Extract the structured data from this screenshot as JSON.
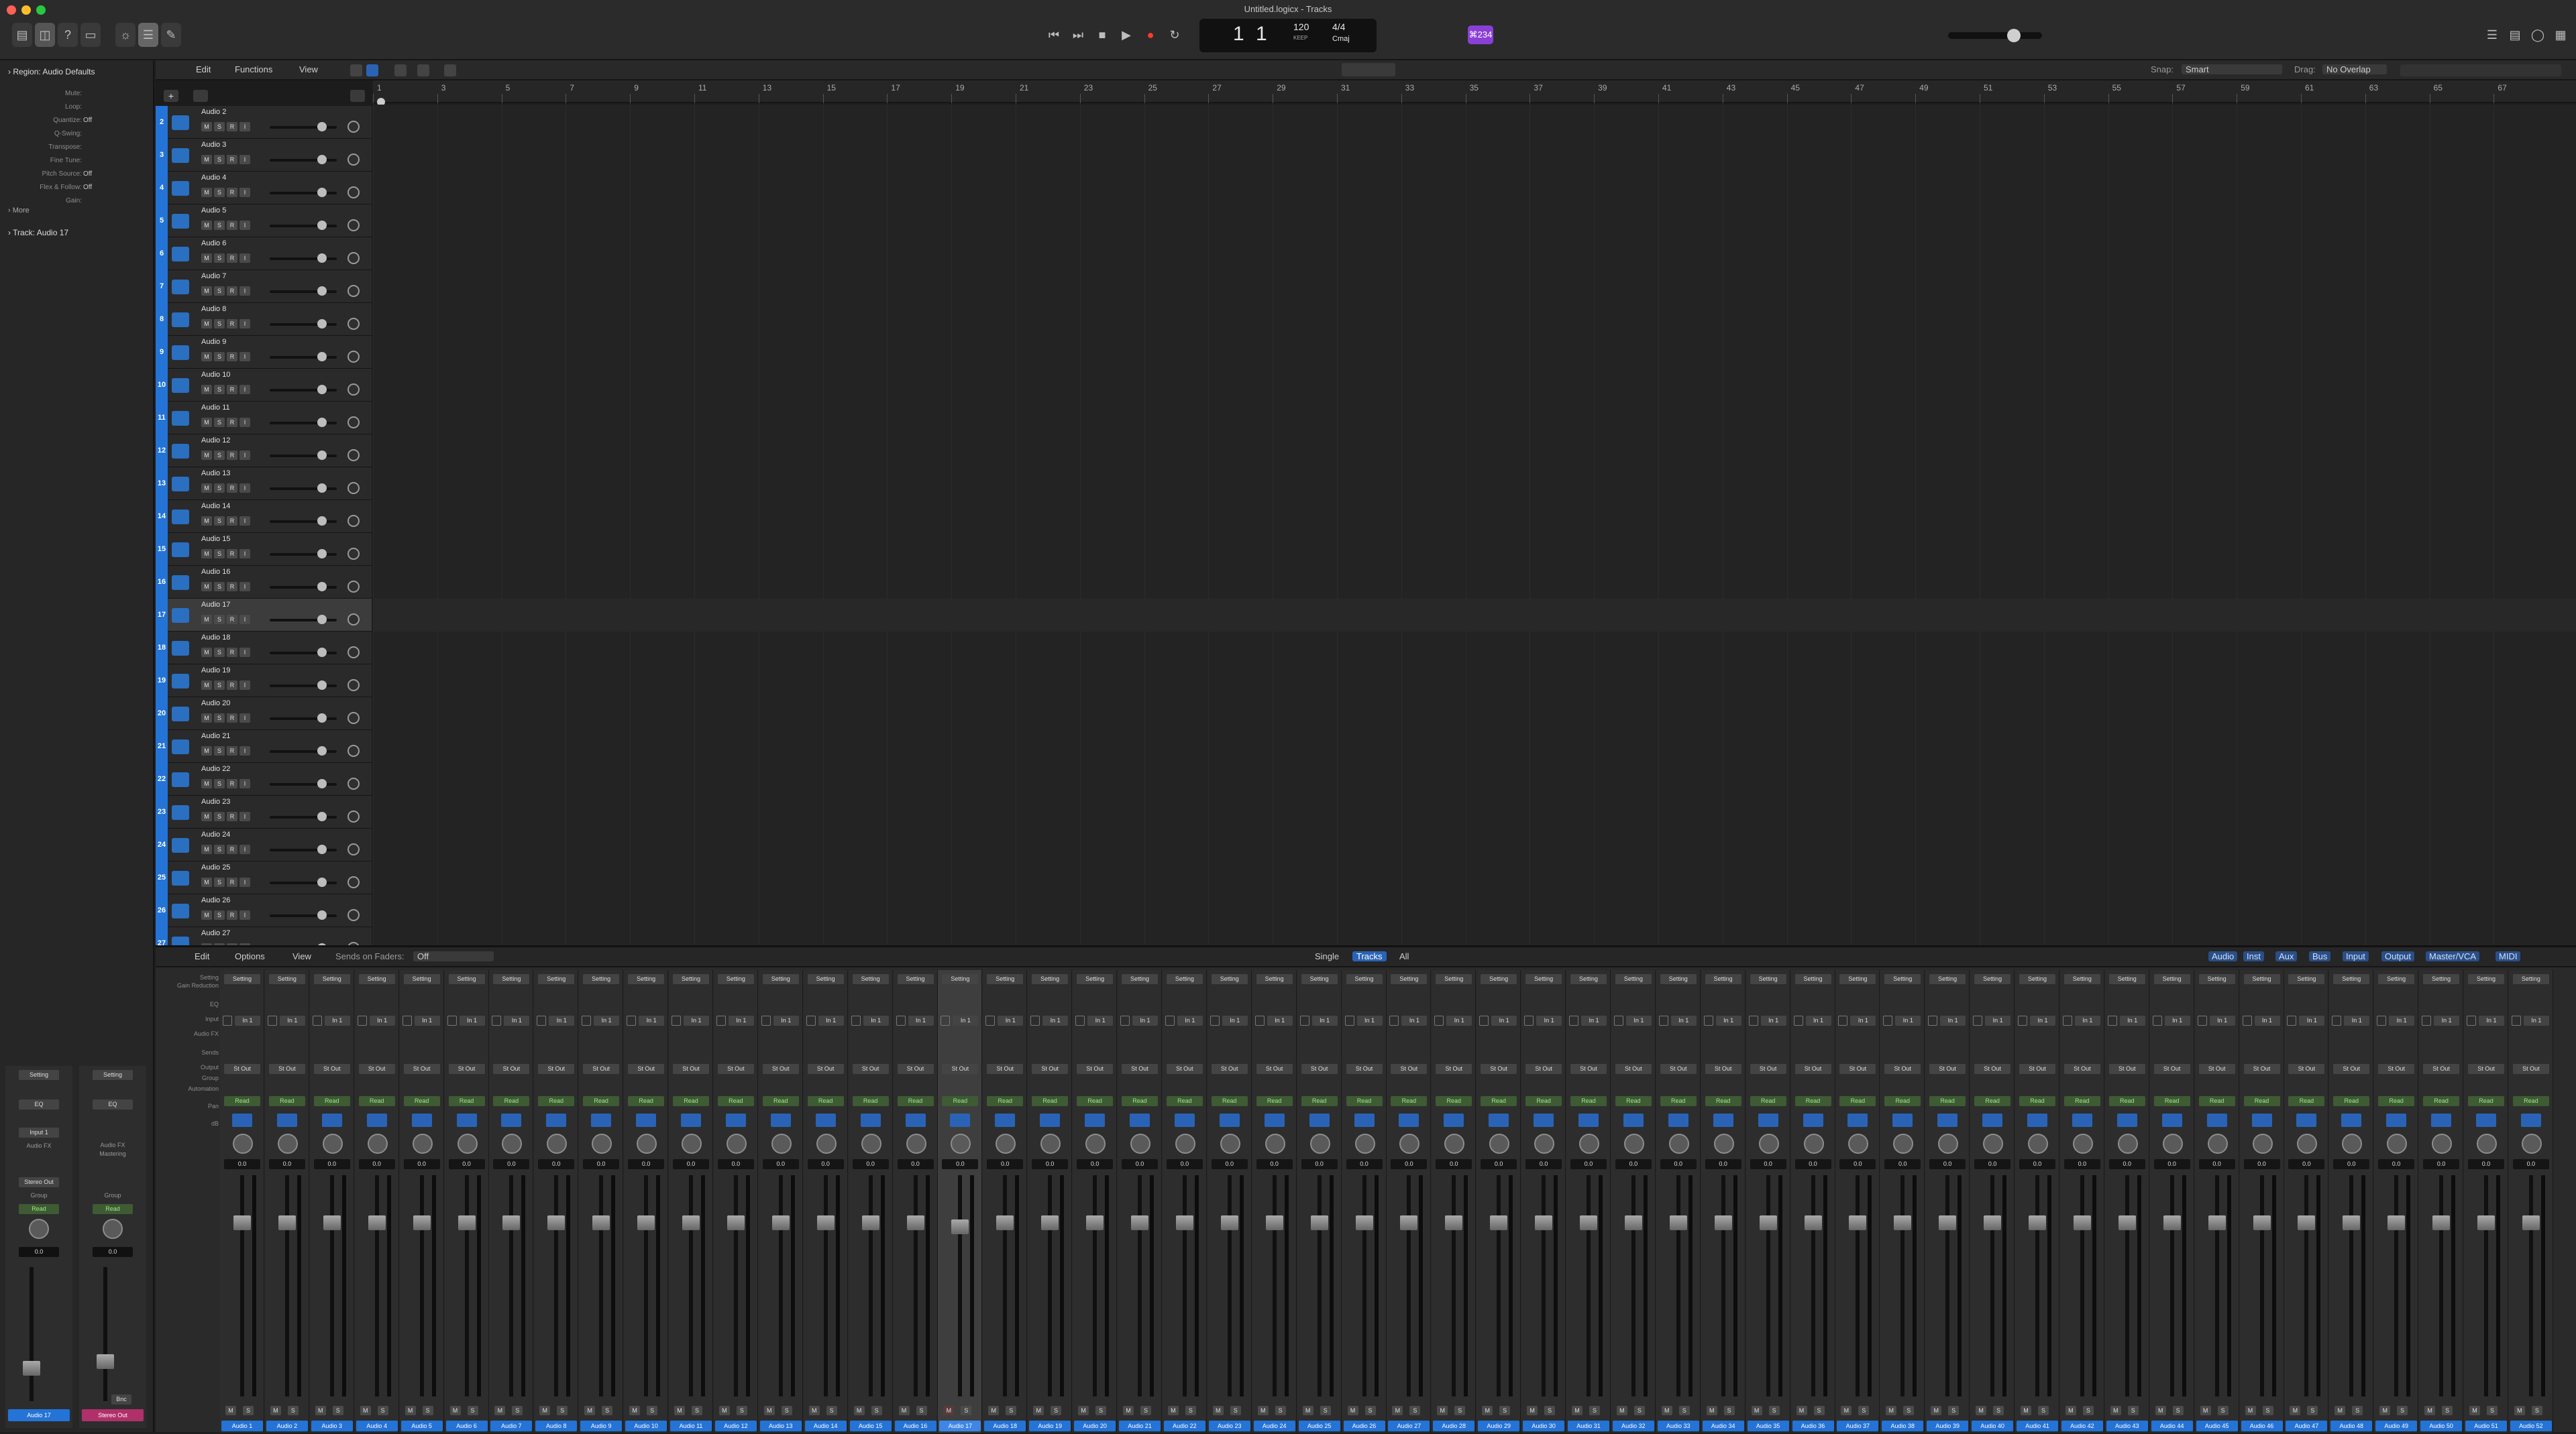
{
  "window": {
    "title": "Untitled.logicx - Tracks"
  },
  "lcd": {
    "bar": "1",
    "beat": "1",
    "tempo": "120",
    "tempo_label": "KEEP",
    "sig": "4/4",
    "key": "Cmaj"
  },
  "badge": "⌘234",
  "inspector": {
    "region_label": "Region:",
    "region_name": "Audio Defaults",
    "rows": [
      {
        "l": "Mute:",
        "v": ""
      },
      {
        "l": "Loop:",
        "v": ""
      },
      {
        "l": "Quantize:",
        "v": "Off"
      },
      {
        "l": "Q-Swing:",
        "v": ""
      },
      {
        "l": "Transpose:",
        "v": ""
      },
      {
        "l": "Fine Tune:",
        "v": ""
      },
      {
        "l": "Pitch Source:",
        "v": "Off"
      },
      {
        "l": "Flex & Follow:",
        "v": "Off"
      },
      {
        "l": "Gain:",
        "v": ""
      }
    ],
    "more": "More",
    "track_label": "Track:",
    "track_name": "Audio 17",
    "strip1": {
      "setting": "Setting",
      "eq": "EQ",
      "input": "Input 1",
      "fx": "Audio FX",
      "group": "Group",
      "read": "Read",
      "out": "Stereo Out",
      "val": "0.0",
      "name": "Audio 17"
    },
    "strip2": {
      "setting": "Setting",
      "eq": "EQ",
      "fx": "Audio FX Mastering",
      "group": "Group",
      "read": "Read",
      "val": "0.0",
      "name": "Stereo Out",
      "bnc": "Bnc"
    }
  },
  "toolbar": {
    "edit": "Edit",
    "functions": "Functions",
    "view": "View",
    "snap_label": "Snap:",
    "snap": "Smart",
    "drag_label": "Drag:",
    "drag": "No Overlap"
  },
  "ruler": [
    "1",
    "3",
    "5",
    "7",
    "9",
    "11",
    "13",
    "15",
    "17",
    "19",
    "21",
    "23",
    "25",
    "27",
    "29",
    "31",
    "33",
    "35",
    "37",
    "39",
    "41",
    "43",
    "45",
    "47",
    "49",
    "51",
    "53",
    "55",
    "57",
    "59",
    "61",
    "63",
    "65",
    "67"
  ],
  "tracks": [
    {
      "n": "2",
      "name": "Audio 2"
    },
    {
      "n": "3",
      "name": "Audio 3"
    },
    {
      "n": "4",
      "name": "Audio 4"
    },
    {
      "n": "5",
      "name": "Audio 5"
    },
    {
      "n": "6",
      "name": "Audio 6"
    },
    {
      "n": "7",
      "name": "Audio 7"
    },
    {
      "n": "8",
      "name": "Audio 8"
    },
    {
      "n": "9",
      "name": "Audio 9"
    },
    {
      "n": "10",
      "name": "Audio 10"
    },
    {
      "n": "11",
      "name": "Audio 11"
    },
    {
      "n": "12",
      "name": "Audio 12"
    },
    {
      "n": "13",
      "name": "Audio 13"
    },
    {
      "n": "14",
      "name": "Audio 14"
    },
    {
      "n": "15",
      "name": "Audio 15"
    },
    {
      "n": "16",
      "name": "Audio 16"
    },
    {
      "n": "17",
      "name": "Audio 17"
    },
    {
      "n": "18",
      "name": "Audio 18"
    },
    {
      "n": "19",
      "name": "Audio 19"
    },
    {
      "n": "20",
      "name": "Audio 20"
    },
    {
      "n": "21",
      "name": "Audio 21"
    },
    {
      "n": "22",
      "name": "Audio 22"
    },
    {
      "n": "23",
      "name": "Audio 23"
    },
    {
      "n": "24",
      "name": "Audio 24"
    },
    {
      "n": "25",
      "name": "Audio 25"
    },
    {
      "n": "26",
      "name": "Audio 26"
    },
    {
      "n": "27",
      "name": "Audio 27"
    }
  ],
  "track_buttons": [
    "M",
    "S",
    "R",
    "I"
  ],
  "mixer": {
    "edit": "Edit",
    "options": "Options",
    "view": "View",
    "sends_label": "Sends on Faders:",
    "sends": "Off",
    "single": "Single",
    "tracks": "Tracks",
    "all": "All",
    "filters": [
      "Audio",
      "Inst",
      "Aux",
      "Bus",
      "Input",
      "Output",
      "Master/VCA",
      "MIDI"
    ],
    "row_labels": [
      "Setting",
      "Gain Reduction",
      "EQ",
      "Input",
      "Audio FX",
      "Sends",
      "Output",
      "Group",
      "Automation",
      "Pan",
      "dB"
    ],
    "strip_setting": "Setting",
    "strip_input": "In 1",
    "strip_output": "St Out",
    "strip_read": "Read",
    "strip_db": "0.0",
    "strips": [
      "Audio 1",
      "Audio 2",
      "Audio 3",
      "Audio 4",
      "Audio 5",
      "Audio 6",
      "Audio 7",
      "Audio 8",
      "Audio 9",
      "Audio 10",
      "Audio 11",
      "Audio 12",
      "Audio 13",
      "Audio 14",
      "Audio 15",
      "Audio 16",
      "Audio 17",
      "Audio 18",
      "Audio 19",
      "Audio 20",
      "Audio 21",
      "Audio 22",
      "Audio 23",
      "Audio 24",
      "Audio 25",
      "Audio 26",
      "Audio 27",
      "Audio 28",
      "Audio 29",
      "Audio 30",
      "Audio 31",
      "Audio 32",
      "Audio 33",
      "Audio 34",
      "Audio 35",
      "Audio 36",
      "Audio 37",
      "Audio 38",
      "Audio 39",
      "Audio 40",
      "Audio 41",
      "Audio 42",
      "Audio 43",
      "Audio 44",
      "Audio 45",
      "Audio 46",
      "Audio 47",
      "Audio 48",
      "Audio 49",
      "Audio 50",
      "Audio 51",
      "Audio 52"
    ]
  }
}
